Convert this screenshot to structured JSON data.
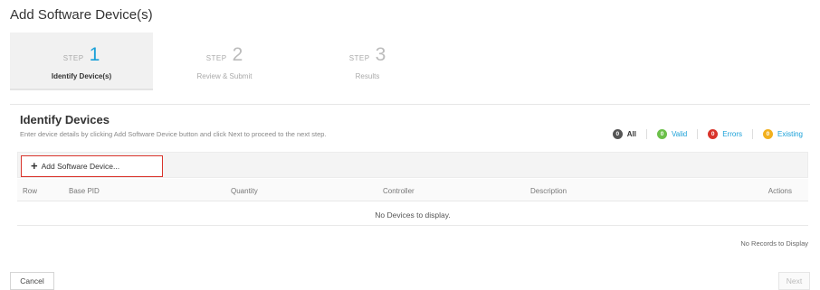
{
  "page": {
    "title": "Add Software Device(s)"
  },
  "wizard": {
    "steps": [
      {
        "word": "STEP",
        "number": "1",
        "label": "Identify Device(s)",
        "active": true
      },
      {
        "word": "STEP",
        "number": "2",
        "label": "Review & Submit",
        "active": false
      },
      {
        "word": "STEP",
        "number": "3",
        "label": "Results",
        "active": false
      }
    ]
  },
  "section": {
    "title": "Identify Devices",
    "description": "Enter device details by clicking Add Software Device button and click Next to proceed to the next step."
  },
  "filters": [
    {
      "count": "0",
      "label": "All",
      "color": "#555555"
    },
    {
      "count": "0",
      "label": "Valid",
      "color": "#6cc04a"
    },
    {
      "count": "0",
      "label": "Errors",
      "color": "#d9342b"
    },
    {
      "count": "0",
      "label": "Existing",
      "color": "#f2b01e"
    }
  ],
  "toolbar": {
    "add_icon": "+",
    "add_label": "Add Software Device..."
  },
  "table": {
    "columns": [
      "Row",
      "Base PID",
      "Quantity",
      "Controller",
      "Description",
      "Actions"
    ],
    "empty_message": "No Devices to display.",
    "records_text": "No Records to Display"
  },
  "footer": {
    "cancel_label": "Cancel",
    "next_label": "Next"
  }
}
